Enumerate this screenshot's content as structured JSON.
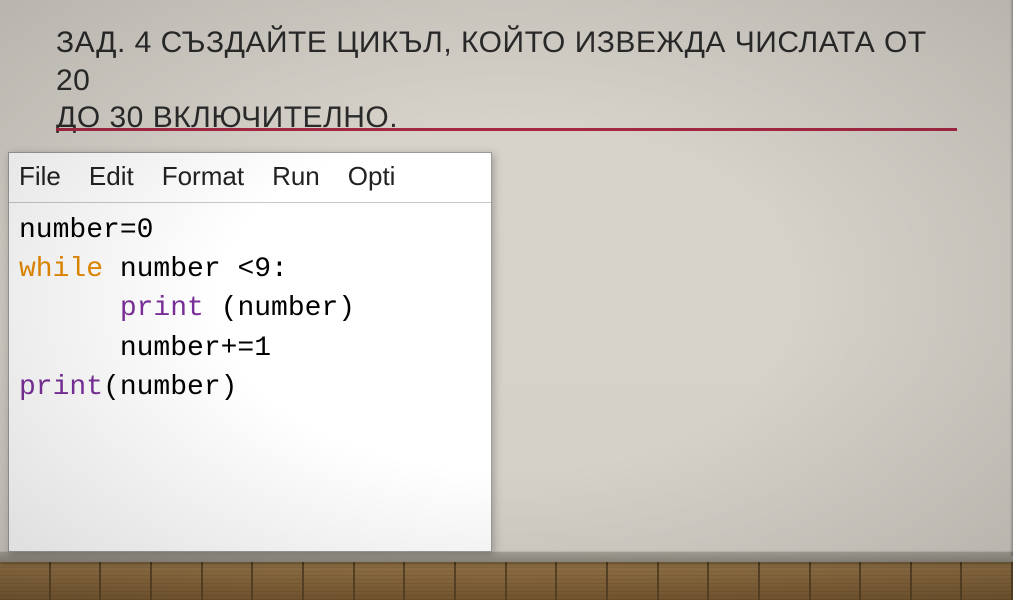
{
  "title": {
    "line1": "ЗАД. 4 СЪЗДАЙТЕ ЦИКЪЛ, КОЙТО ИЗВЕЖДА  ЧИСЛАТА ОТ 20",
    "line2": "ДО 30 ВКЛЮЧИТЕЛНО."
  },
  "menu": {
    "file": "File",
    "edit": "Edit",
    "format": "Format",
    "run": "Run",
    "options_truncated": "Opti"
  },
  "code": {
    "l1_text": "number=0",
    "l2_kw": "while",
    "l2_text": " number <9:",
    "l3_indent": "      ",
    "l3_fn": "print",
    "l3_text": " (number)",
    "l4_text": "      number+=1",
    "l5_fn": "print",
    "l5_text": "(number)"
  }
}
